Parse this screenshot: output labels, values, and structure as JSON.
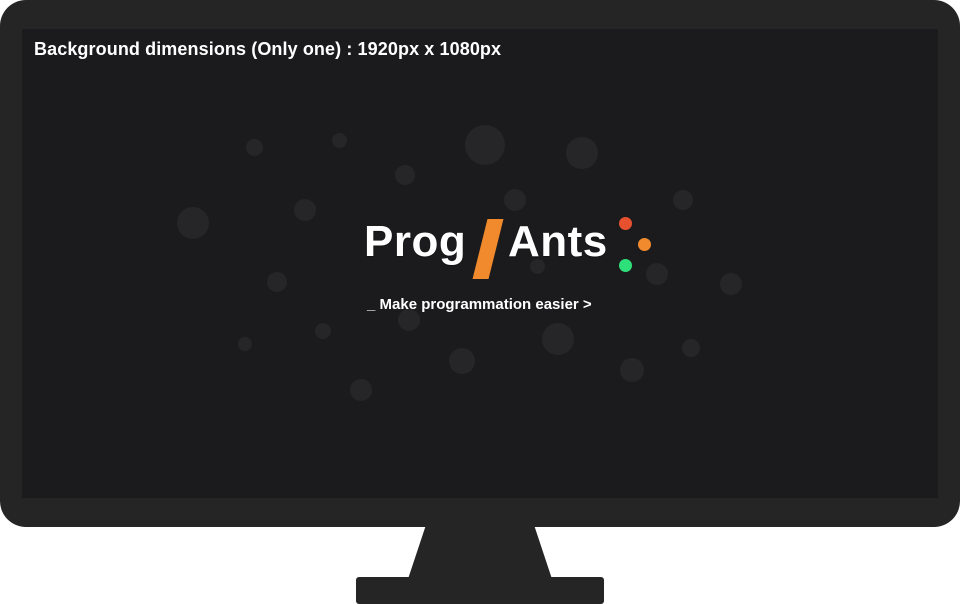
{
  "screen": {
    "dimensions_text": "Background dimensions (Only one) : 1920px x 1080px"
  },
  "logo": {
    "left_text": "Prog",
    "right_text": "Ants",
    "slash_color": "#f08a2c",
    "dot_colors": [
      "#e8512f",
      "#f08a2c",
      "#2ee07a"
    ]
  },
  "tagline": "_ Make programmation easier >"
}
